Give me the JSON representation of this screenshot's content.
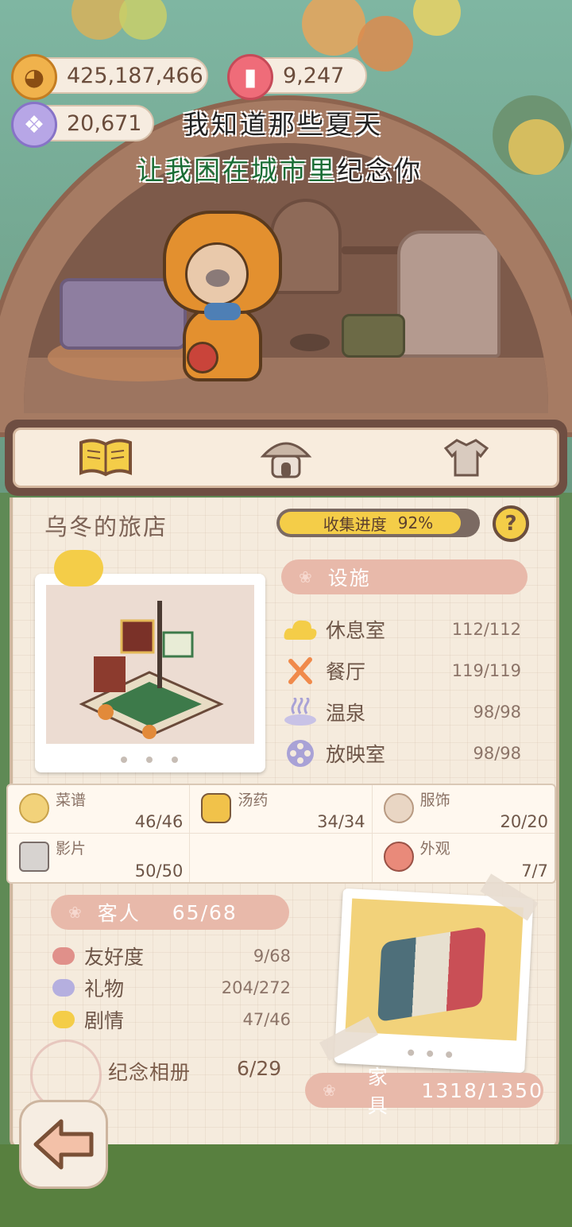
{
  "currencies": {
    "coins": "425,187,466",
    "candles": "9,247",
    "candy": "20,671"
  },
  "lyrics": {
    "line1": "我知道那些夏天",
    "line2_green": "让我困在城市里",
    "line2_white": "纪念你"
  },
  "tabs": [
    {
      "name": "book",
      "icon": "open-book-icon"
    },
    {
      "name": "hotel",
      "icon": "hotel-mushroom-icon"
    },
    {
      "name": "outfit",
      "icon": "shirt-icon"
    }
  ],
  "inn": {
    "title": "乌冬的旅店",
    "progress_label": "收集进度",
    "progress_value": "92%",
    "progress_fraction": 0.92,
    "help": "?"
  },
  "facilities": {
    "header": "设施",
    "items": [
      {
        "name": "休息室",
        "count": "112/112",
        "icon": "cloud-icon",
        "color": "#f4cd48"
      },
      {
        "name": "餐厅",
        "count": "119/119",
        "icon": "fork-knife-icon",
        "color": "#f08a4b"
      },
      {
        "name": "温泉",
        "count": "98/98",
        "icon": "hot-spring-icon",
        "color": "#a9a2d6"
      },
      {
        "name": "放映室",
        "count": "98/98",
        "icon": "film-reel-icon",
        "color": "#a9a2d6"
      }
    ]
  },
  "collections": [
    {
      "name": "菜谱",
      "count": "46/46",
      "icon": "dish-icon"
    },
    {
      "name": "汤药",
      "count": "34/34",
      "icon": "potion-jar-icon"
    },
    {
      "name": "服饰",
      "count": "20/20",
      "icon": "bear-outfit-icon"
    },
    {
      "name": "影片",
      "count": "50/50",
      "icon": "clapperboard-icon"
    },
    {
      "name": "",
      "count": "",
      "icon": ""
    },
    {
      "name": "外观",
      "count": "7/7",
      "icon": "hotel-exterior-icon"
    }
  ],
  "guests": {
    "header": "客人",
    "count": "65/68",
    "rows": [
      {
        "name": "友好度",
        "count": "9/68",
        "color": "#e0908a"
      },
      {
        "name": "礼物",
        "count": "204/272",
        "color": "#b5afdf"
      },
      {
        "name": "剧情",
        "count": "47/46",
        "color": "#f4cd48"
      }
    ]
  },
  "album": {
    "label": "纪念相册",
    "count": "6/29"
  },
  "furniture": {
    "label": "家具",
    "count": "1318/1350"
  }
}
